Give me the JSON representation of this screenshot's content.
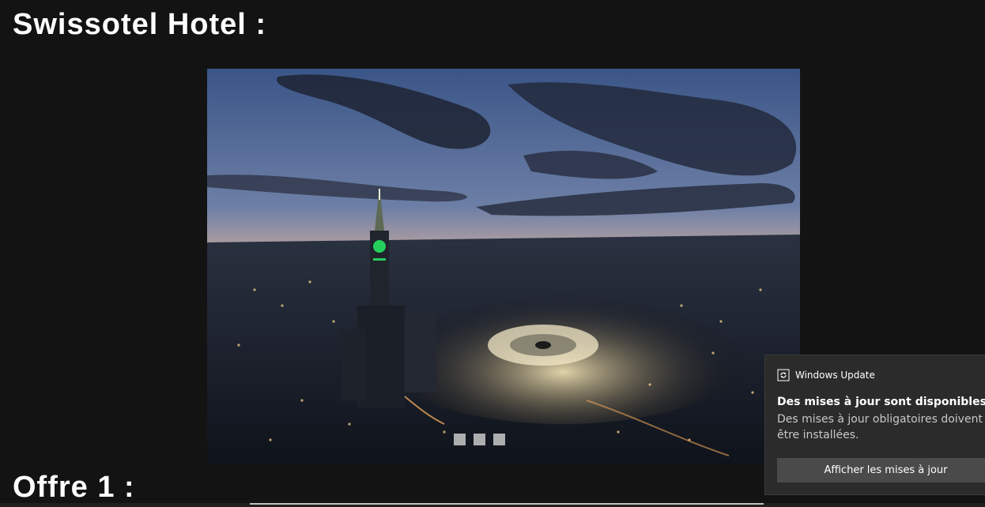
{
  "page": {
    "title": "Swissotel Hotel :",
    "section_title": "Offre 1 :"
  },
  "slideshow": {
    "dot_count": 3
  },
  "toast": {
    "app_name": "Windows Update",
    "title": "Des mises à jour sont disponibles",
    "body": "Des mises à jour obligatoires doivent être installées.",
    "button_label": "Afficher les mises à jour",
    "icon": "windows-update-icon"
  },
  "colors": {
    "background": "#131313",
    "toast_background": "#2b2b2b",
    "toast_button": "#4a4a4a"
  }
}
